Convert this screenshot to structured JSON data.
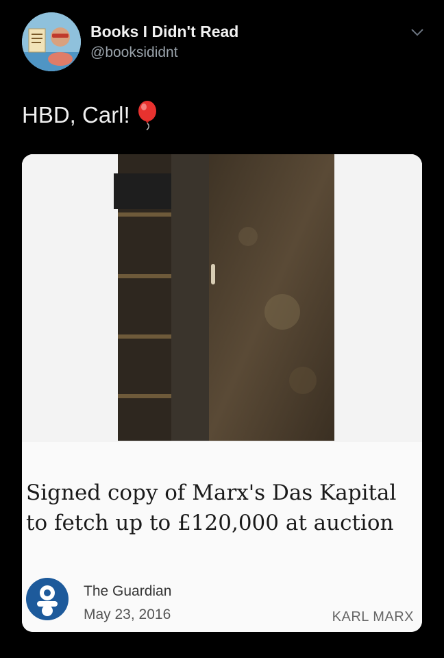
{
  "tweet": {
    "author_name": "Books I Didn't Read",
    "author_handle": "@booksididnt",
    "text": "HBD, Carl!",
    "emoji_icon": "balloon-icon"
  },
  "card": {
    "headline": "Signed copy of Marx's Das Kapital to fetch up to £120,000 at auction",
    "source": "The Guardian",
    "date": "May 23, 2016",
    "tag": "KARL MARX",
    "source_logo_icon": "guardian-g-icon"
  },
  "colors": {
    "background": "#000000",
    "handle": "#9aa3ab",
    "guardian_blue": "#1d5a9b",
    "balloon": "#e8322f"
  }
}
